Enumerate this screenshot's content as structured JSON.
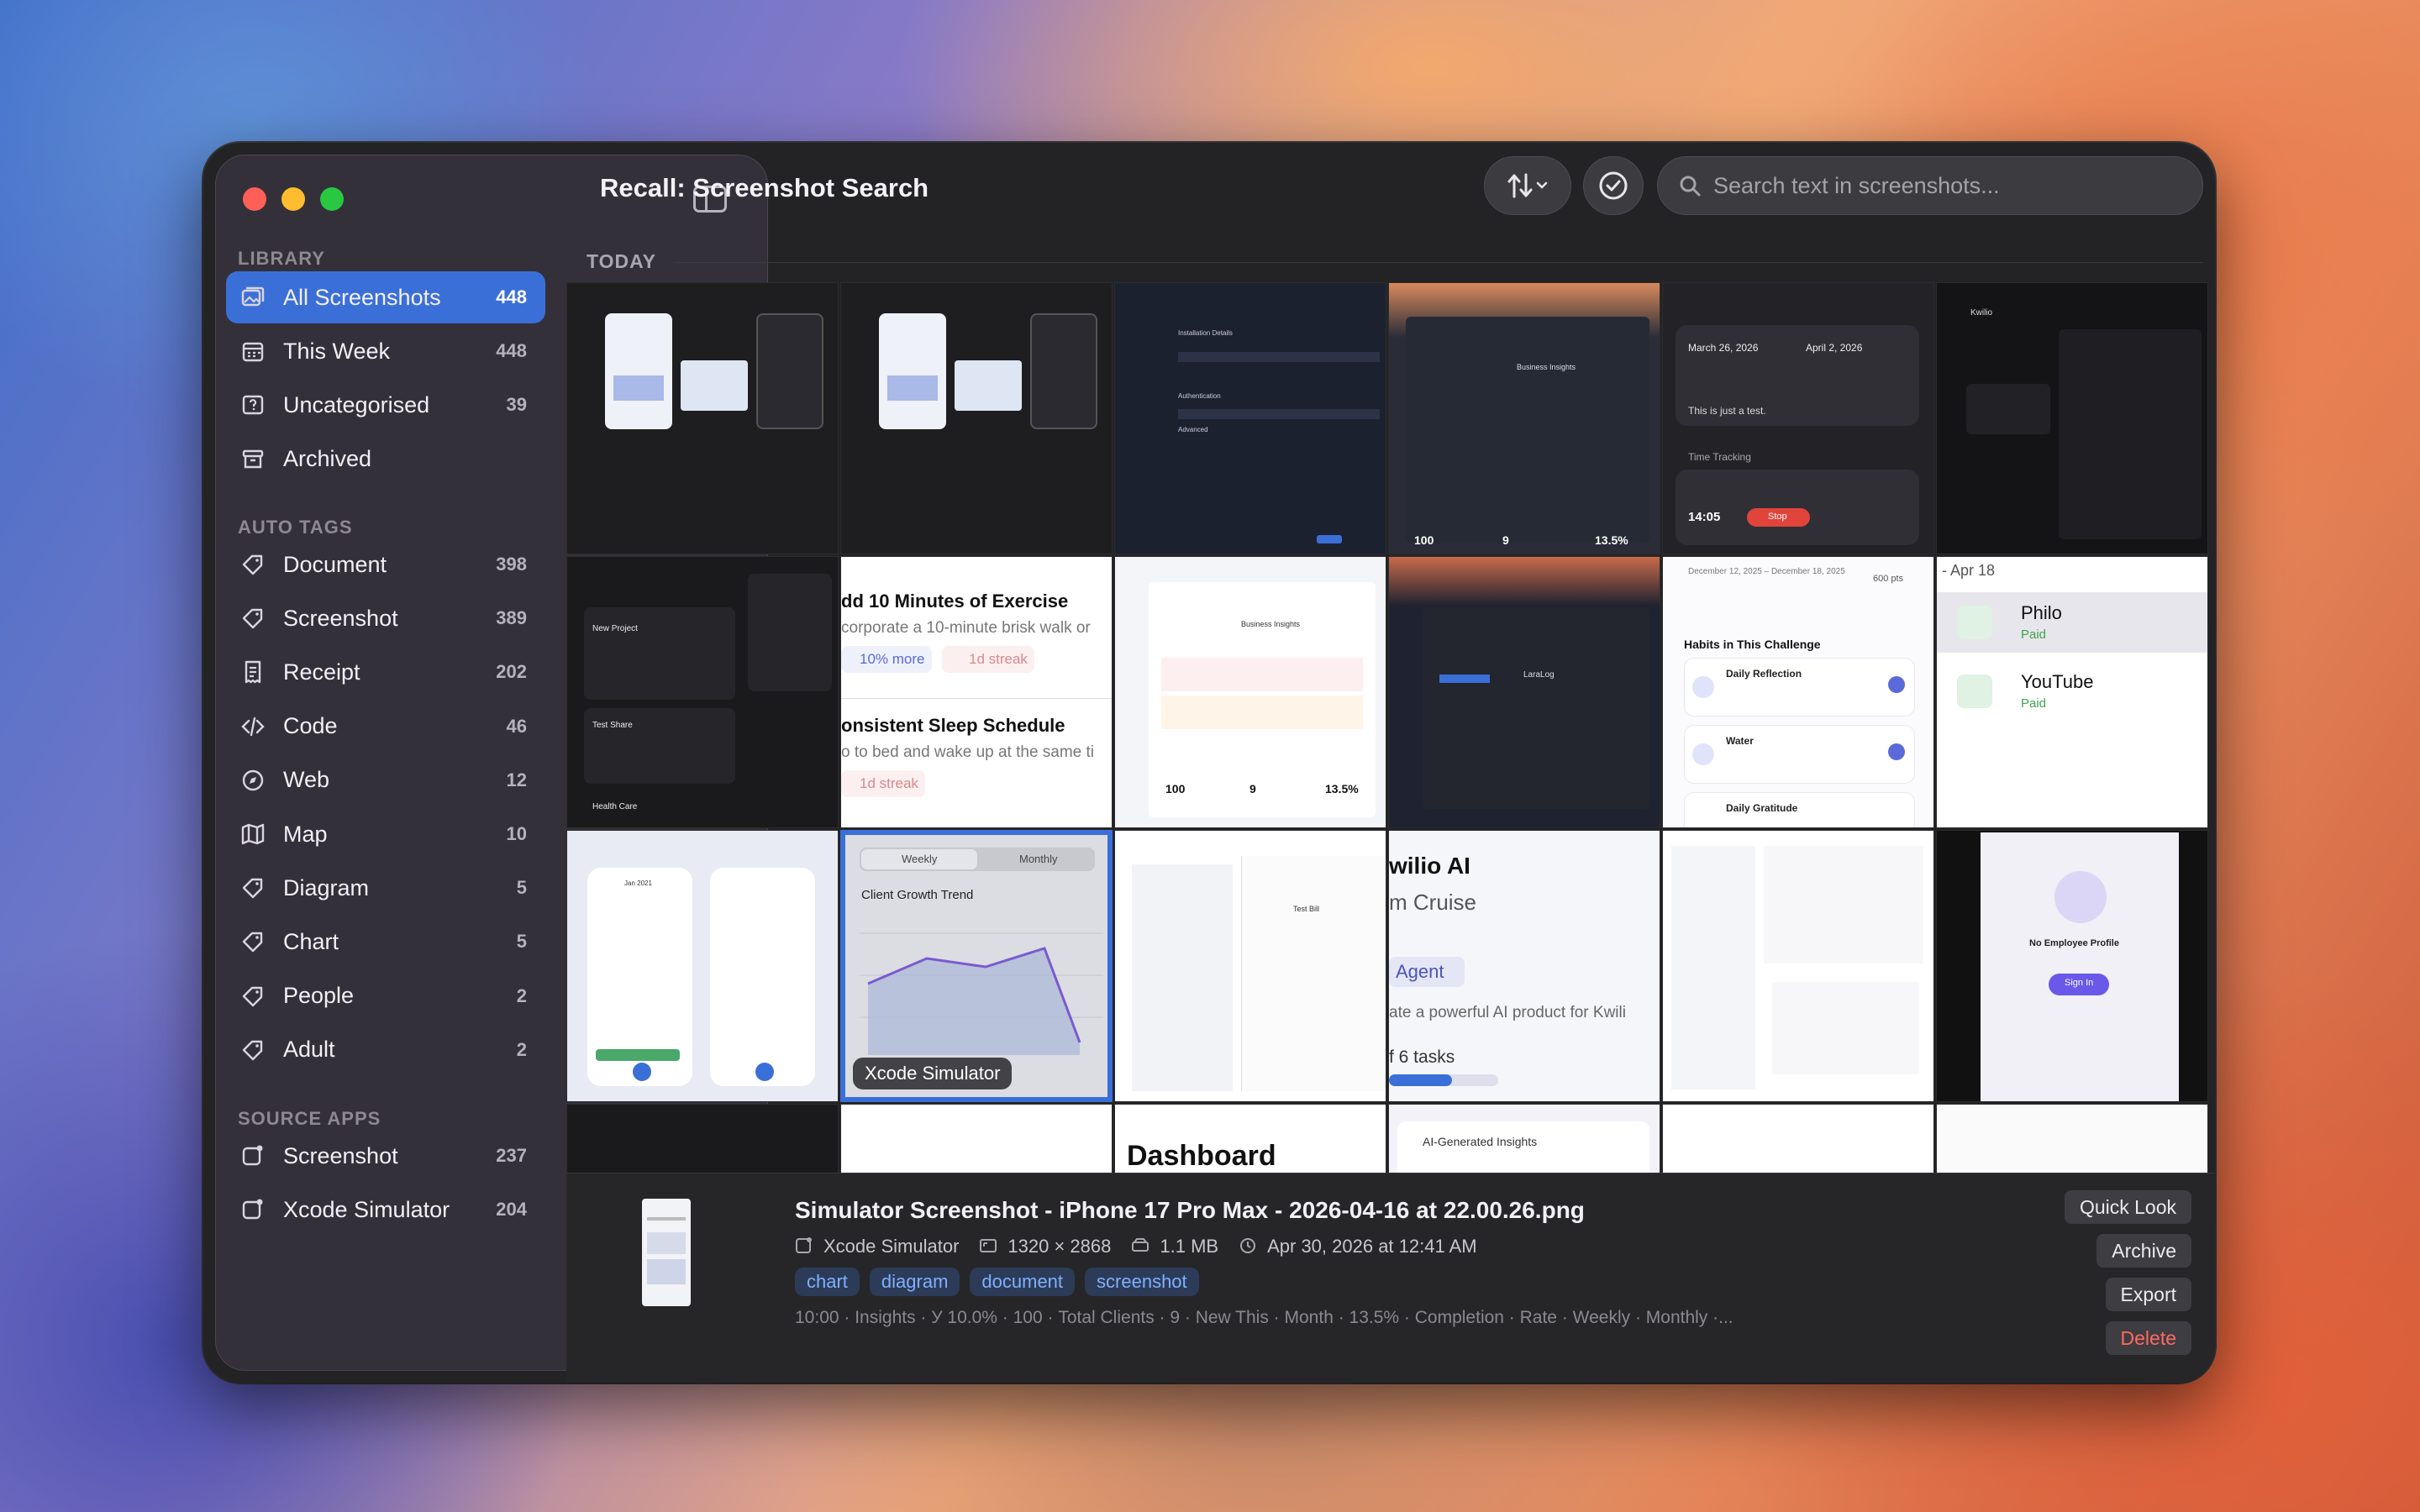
{
  "window": {
    "title": "Recall: Screenshot Search"
  },
  "sidebar": {
    "library_label": "LIBRARY",
    "library": [
      {
        "label": "All Screenshots",
        "count": "448",
        "icon": "photos-icon",
        "active": true
      },
      {
        "label": "This Week",
        "count": "448",
        "icon": "calendar-icon"
      },
      {
        "label": "Uncategorised",
        "count": "39",
        "icon": "question-box-icon"
      },
      {
        "label": "Archived",
        "count": "",
        "icon": "archive-box-icon"
      }
    ],
    "auto_tags_label": "AUTO TAGS",
    "auto_tags": [
      {
        "label": "Document",
        "count": "398",
        "icon": "tag-icon"
      },
      {
        "label": "Screenshot",
        "count": "389",
        "icon": "tag-icon"
      },
      {
        "label": "Receipt",
        "count": "202",
        "icon": "receipt-icon"
      },
      {
        "label": "Code",
        "count": "46",
        "icon": "code-icon"
      },
      {
        "label": "Web",
        "count": "12",
        "icon": "compass-icon"
      },
      {
        "label": "Map",
        "count": "10",
        "icon": "map-icon"
      },
      {
        "label": "Diagram",
        "count": "5",
        "icon": "tag-icon"
      },
      {
        "label": "Chart",
        "count": "5",
        "icon": "tag-icon"
      },
      {
        "label": "People",
        "count": "2",
        "icon": "tag-icon"
      },
      {
        "label": "Adult",
        "count": "2",
        "icon": "tag-icon"
      }
    ],
    "source_apps_label": "SOURCE APPS",
    "source_apps": [
      {
        "label": "Screenshot",
        "count": "237",
        "icon": "app-icon"
      },
      {
        "label": "Xcode Simulator",
        "count": "204",
        "icon": "app-icon"
      }
    ]
  },
  "toolbar": {
    "search_placeholder": "Search text in screenshots...",
    "sort_icon": "sort-arrows-icon",
    "select_icon": "checkmark-circle-icon"
  },
  "grid": {
    "section_label": "TODAY",
    "thumb_texts": {
      "t3_a": "Installation Details",
      "t3_b": "Authentication",
      "t3_c": "Advanced",
      "t4_a": "Business Insights",
      "t4_v1": "100",
      "t4_v2": "9",
      "t4_v3": "13.5%",
      "t5_d1": "March 26, 2026",
      "t5_d2": "April 2, 2026",
      "t5_desc": "This is just a test.",
      "t5_tt": "Time Tracking",
      "t5_time": "14:05",
      "t5_stop": "Stop",
      "t6_a": "Kwilio",
      "t7_a": "New Project",
      "t7_b": "Test Share",
      "t7_c": "Health Care",
      "t8_a": "dd 10 Minutes of Exercise",
      "t8_b": "corporate a 10-minute brisk walk or",
      "t8_c": "10% more",
      "t8_d": "1d streak",
      "t8_e": "onsistent Sleep Schedule",
      "t8_f": "o to bed and wake up at the same ti",
      "t8_g": "1d streak",
      "t9_a": "Business Insights",
      "t9_v1": "100",
      "t9_v2": "9",
      "t9_v3": "13.5%",
      "t10_a": "LaraLog",
      "t11_a": "December 12, 2025 – December 18, 2025",
      "t11_pts": "600 pts",
      "t11_b": "Habits in This Challenge",
      "t11_c": "Daily Reflection",
      "t11_d": "Water",
      "t11_e": "Daily Gratitude",
      "t12_date": "- Apr 18",
      "t12_a": "Philo",
      "t12_a_s": "Paid",
      "t12_b": "YouTube",
      "t12_b_s": "Paid",
      "t13_a": "Jan 2021",
      "t14_tab1": "Weekly",
      "t14_tab2": "Monthly",
      "t14_title": "Client Growth Trend",
      "t14_overlay": "Xcode Simulator",
      "t15_a": "Test Bill",
      "t16_a": "wilio AI",
      "t16_b": "m Cruise",
      "t16_c": "Agent",
      "t16_d": "ate a powerful AI product for Kwili",
      "t16_e": "f 6 tasks",
      "t18_a": "No Employee Profile",
      "t18_b": "Sign In",
      "t20_a": "Dashboard",
      "t21_a": "AI-Generated Insights"
    }
  },
  "detail": {
    "filename": "Simulator Screenshot - iPhone 17 Pro Max - 2026-04-16 at 22.00.26.png",
    "source_app": "Xcode Simulator",
    "dimensions": "1320 × 2868",
    "size": "1.1 MB",
    "date": "Apr 30, 2026 at 12:41 AM",
    "tags": [
      "chart",
      "diagram",
      "document",
      "screenshot"
    ],
    "ocr_text": "10:00 · Insights · У 10.0% · 100 · Total Clients · 9 · New This · Month · 13.5% · Completion · Rate · Weekly · Monthly ·...",
    "buttons": {
      "quick_look": "Quick Look",
      "archive": "Archive",
      "export": "Export",
      "delete": "Delete"
    }
  },
  "colors": {
    "accent": "#3b6fd8",
    "danger": "#ff6a60",
    "tag_text": "#7fb0ff"
  }
}
